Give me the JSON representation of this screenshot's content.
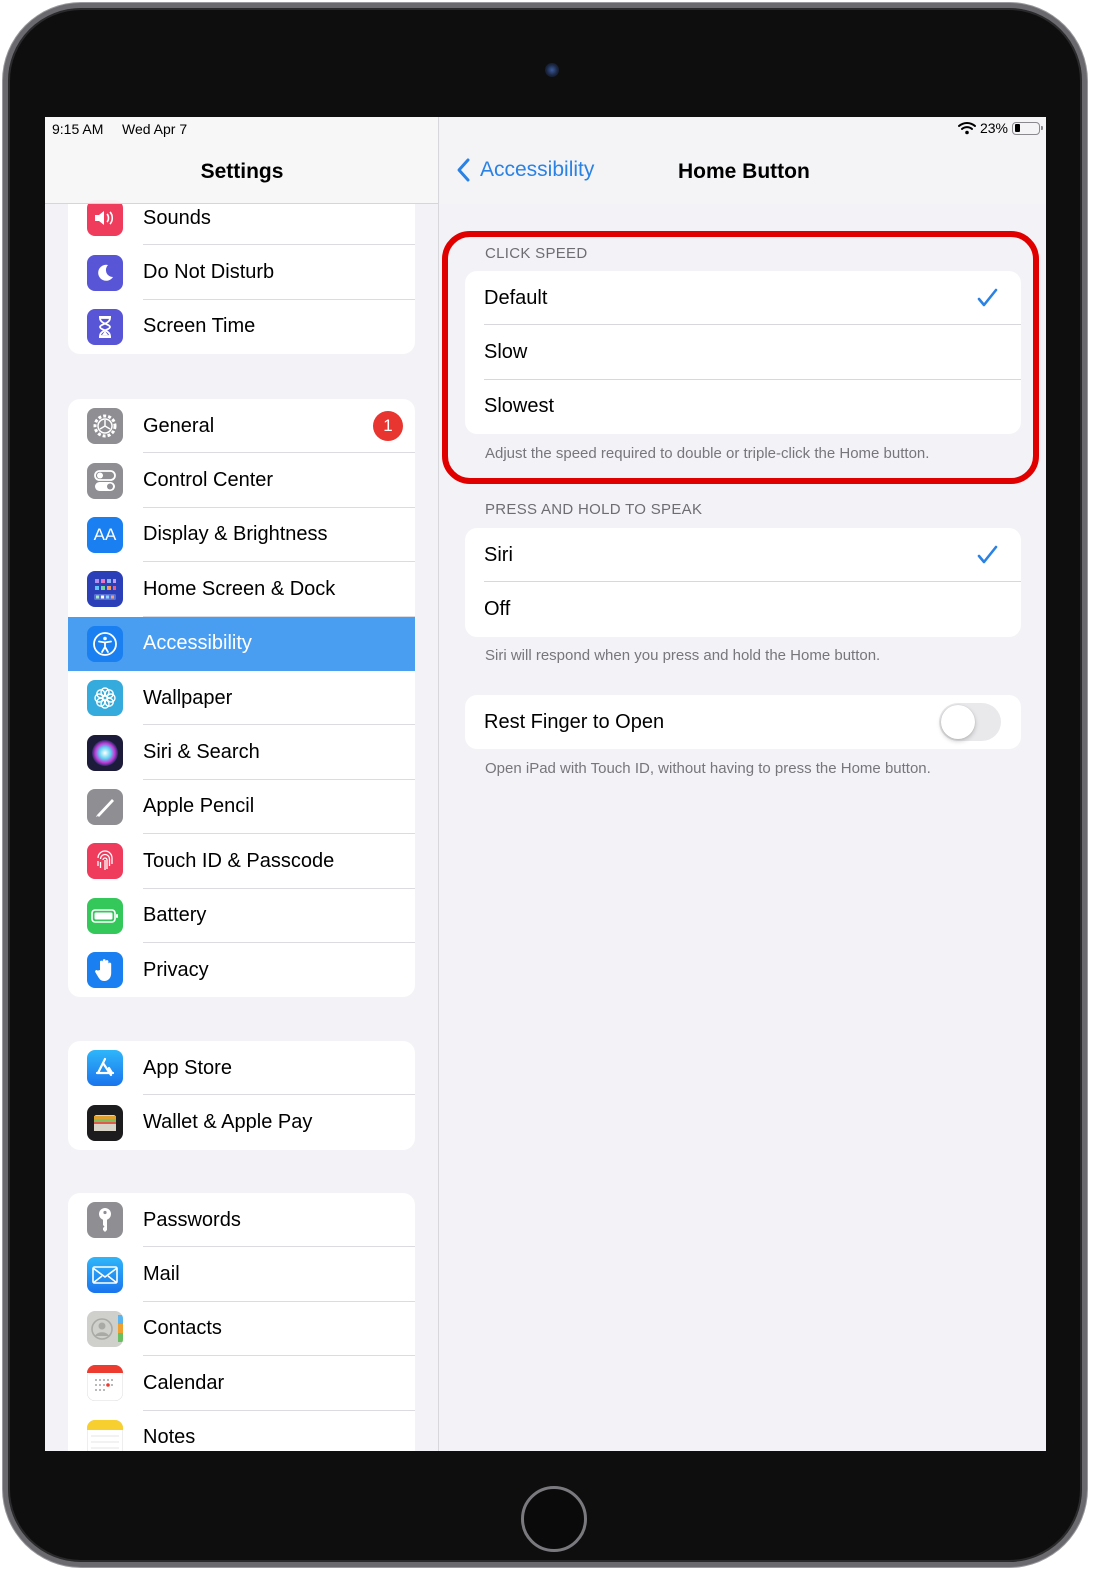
{
  "status_bar": {
    "time": "9:15 AM",
    "date": "Wed Apr 7",
    "wifi_icon": "wifi-icon",
    "battery_percent_label": "23%",
    "battery_level": 0.23
  },
  "sidebar": {
    "title": "Settings",
    "groups": [
      {
        "items": [
          {
            "label": "Sounds",
            "icon": "speaker-icon",
            "color": "#ef3b5c"
          },
          {
            "label": "Do Not Disturb",
            "icon": "moon-icon",
            "color": "#5856d6"
          },
          {
            "label": "Screen Time",
            "icon": "hourglass-icon",
            "color": "#5856d6"
          }
        ]
      },
      {
        "items": [
          {
            "label": "General",
            "icon": "gear-icon",
            "color": "#8e8e93",
            "badge": "1"
          },
          {
            "label": "Control Center",
            "icon": "toggles-icon",
            "color": "#8e8e93"
          },
          {
            "label": "Display & Brightness",
            "icon": "text-size-icon",
            "color": "#1a7ff0",
            "glyph": "AA"
          },
          {
            "label": "Home Screen & Dock",
            "icon": "app-grid-icon",
            "color": "#2b3fb8"
          },
          {
            "label": "Accessibility",
            "icon": "accessibility-icon",
            "color": "#1a7ff0",
            "selected": true
          },
          {
            "label": "Wallpaper",
            "icon": "flower-icon",
            "color": "#35aadc"
          },
          {
            "label": "Siri & Search",
            "icon": "siri-icon",
            "color": "#1c1c3a"
          },
          {
            "label": "Apple Pencil",
            "icon": "pencil-icon",
            "color": "#8e8e93"
          },
          {
            "label": "Touch ID & Passcode",
            "icon": "fingerprint-icon",
            "color": "#ef3b5c"
          },
          {
            "label": "Battery",
            "icon": "battery-icon",
            "color": "#34c759"
          },
          {
            "label": "Privacy",
            "icon": "hand-icon",
            "color": "#1a7ff0"
          }
        ]
      },
      {
        "items": [
          {
            "label": "App Store",
            "icon": "app-store-icon",
            "color": "#1c8ef5"
          },
          {
            "label": "Wallet & Apple Pay",
            "icon": "wallet-icon",
            "color": "#1c1c1e"
          }
        ]
      },
      {
        "items": [
          {
            "label": "Passwords",
            "icon": "key-icon",
            "color": "#8e8e93"
          },
          {
            "label": "Mail",
            "icon": "mail-icon",
            "color": "#1c8ef5"
          },
          {
            "label": "Contacts",
            "icon": "contacts-icon",
            "color": "#c9c9c6"
          },
          {
            "label": "Calendar",
            "icon": "calendar-icon",
            "color": "#ffffff"
          },
          {
            "label": "Notes",
            "icon": "notes-icon",
            "color": "#ffffff"
          }
        ]
      }
    ]
  },
  "detail": {
    "back_label": "Accessibility",
    "title": "Home Button",
    "click_speed": {
      "header": "CLICK SPEED",
      "options": [
        {
          "label": "Default",
          "checked": true
        },
        {
          "label": "Slow",
          "checked": false
        },
        {
          "label": "Slowest",
          "checked": false
        }
      ],
      "footer": "Adjust the speed required to double or triple-click the Home button."
    },
    "press_and_hold": {
      "header": "PRESS AND HOLD TO SPEAK",
      "options": [
        {
          "label": "Siri",
          "checked": true
        },
        {
          "label": "Off",
          "checked": false
        }
      ],
      "footer": "Siri will respond when you press and hold the Home button."
    },
    "rest_finger": {
      "label": "Rest Finger to Open",
      "enabled": false,
      "footer": "Open iPad with Touch ID, without having to press the Home button."
    }
  },
  "colors": {
    "accent": "#2a82e4",
    "selected_row": "#4a9ef2",
    "highlight_box": "#e10000",
    "badge": "#e8352f"
  }
}
